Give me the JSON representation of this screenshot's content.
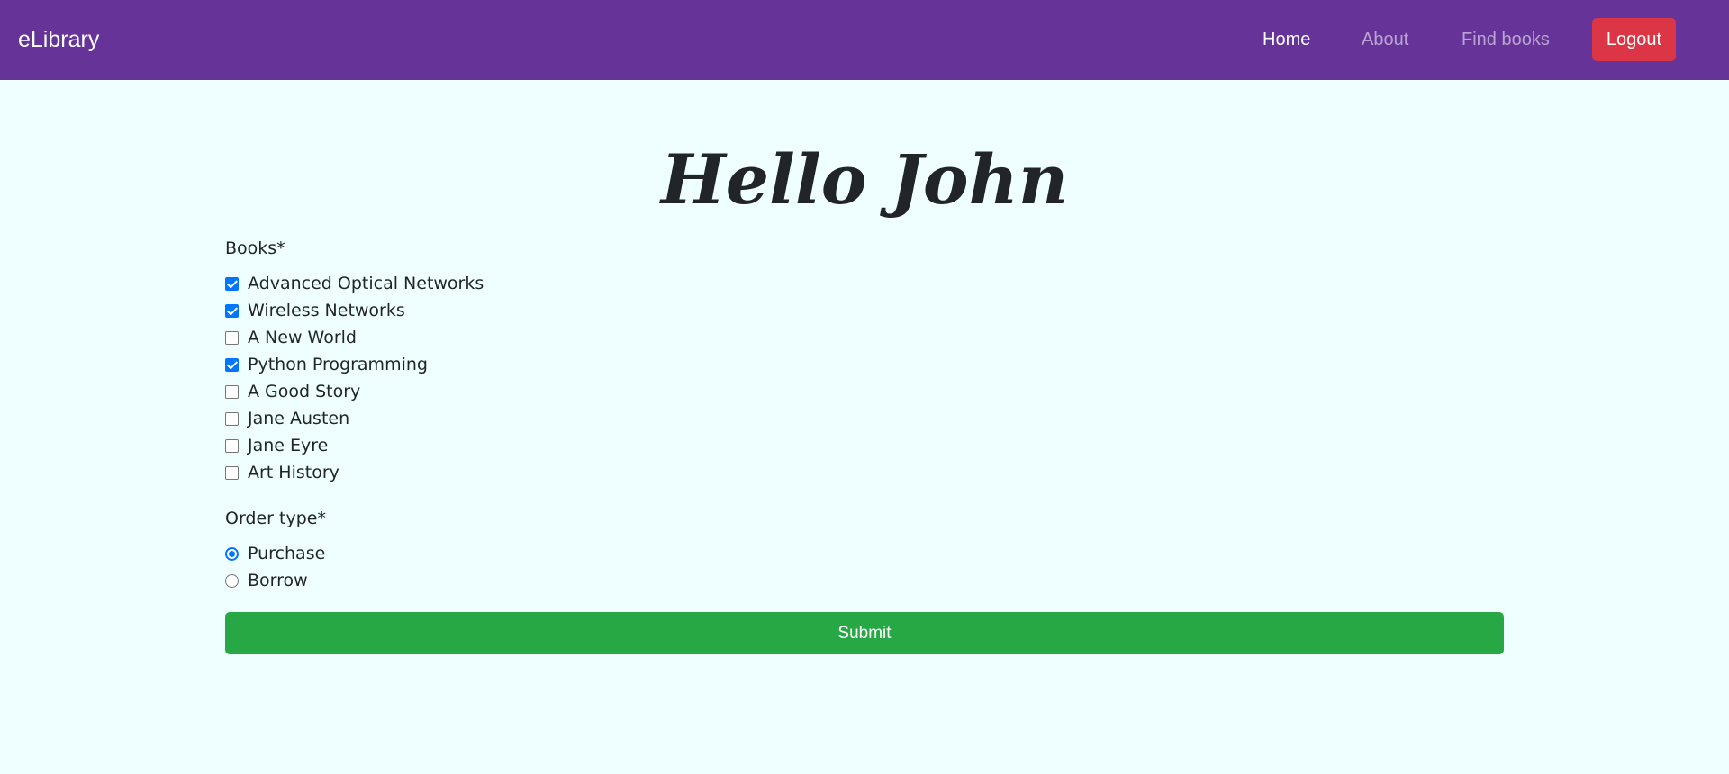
{
  "navbar": {
    "brand": "eLibrary",
    "links": [
      {
        "label": "Home",
        "active": true
      },
      {
        "label": "About",
        "active": false
      },
      {
        "label": "Find books",
        "active": false
      }
    ],
    "logout_label": "Logout"
  },
  "greeting": "Hello John",
  "form": {
    "books_label": "Books*",
    "books": [
      {
        "label": "Advanced Optical Networks",
        "checked": true
      },
      {
        "label": "Wireless Networks",
        "checked": true
      },
      {
        "label": "A New World",
        "checked": false
      },
      {
        "label": "Python Programming",
        "checked": true
      },
      {
        "label": "A Good Story",
        "checked": false
      },
      {
        "label": "Jane Austen",
        "checked": false
      },
      {
        "label": "Jane Eyre",
        "checked": false
      },
      {
        "label": "Art History",
        "checked": false
      }
    ],
    "order_type_label": "Order type*",
    "order_types": [
      {
        "label": "Purchase",
        "selected": true
      },
      {
        "label": "Borrow",
        "selected": false
      }
    ],
    "submit_label": "Submit"
  },
  "colors": {
    "navbar_bg": "#663399",
    "page_bg": "#efffff",
    "logout_bg": "#dc3545",
    "submit_bg": "#28a745",
    "accent": "#0075ff"
  }
}
